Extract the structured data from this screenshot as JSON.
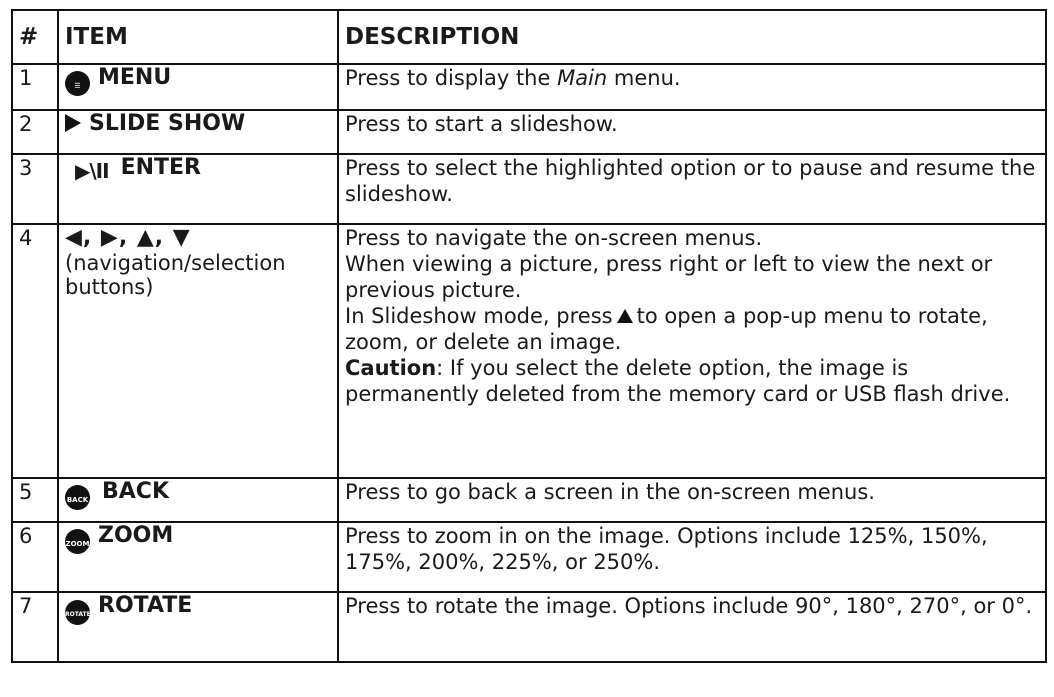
{
  "headers": {
    "num": "#",
    "item": "ITEM",
    "description": "DESCRIPTION"
  },
  "rows": [
    {
      "num": "1",
      "icon": "menu-icon",
      "item": "MENU",
      "desc_parts": [
        "Press to display the ",
        "Main",
        " menu."
      ]
    },
    {
      "num": "2",
      "icon": "play-icon",
      "item": "SLIDE SHOW",
      "desc": "Press to start a slideshow."
    },
    {
      "num": "3",
      "icon": "play-pause-icon",
      "icon_text": "▶\\II",
      "item": "ENTER",
      "desc": "Press to select the highlighted option or to pause and resume the slideshow."
    },
    {
      "num": "4",
      "icon": "arrow-keys-icon",
      "icon_text": "◀, ▶, ▲, ▼",
      "item_sub": "(navigation/selection buttons)",
      "desc_lines": [
        "Press to navigate the on-screen menus.",
        "When viewing a picture, press right or left to view the next or previous picture."
      ],
      "desc_up_parts": [
        "In Slideshow mode, press",
        "to open a pop-up menu to rotate, zoom, or delete an image."
      ],
      "caution_label": "Caution",
      "caution_text": ": If you select the delete option, the image is permanently deleted from the memory card or USB flash drive."
    },
    {
      "num": "5",
      "icon": "back-icon",
      "icon_text": "BACK",
      "item": "BACK",
      "desc": "Press to go back a screen in the on-screen menus."
    },
    {
      "num": "6",
      "icon": "zoom-icon",
      "icon_text": "ZOOM",
      "item": "ZOOM",
      "desc": "Press to zoom in on the image. Options include 125%, 150%, 175%, 200%, 225%, or 250%."
    },
    {
      "num": "7",
      "icon": "rotate-icon",
      "icon_text": "ROTATE",
      "item": "ROTATE",
      "desc": "Press to rotate the image. Options include 90°, 180°, 270°, or 0°."
    }
  ]
}
